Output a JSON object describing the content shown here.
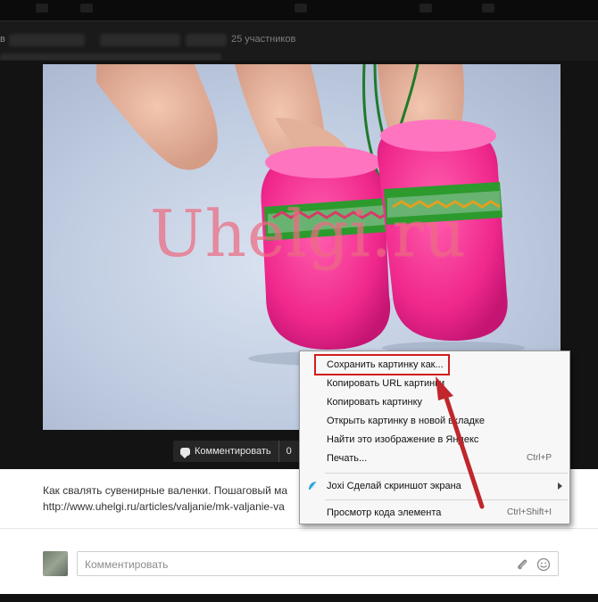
{
  "header": {
    "prefix": "в",
    "members": "25 участников"
  },
  "actions": {
    "comment_label": "Комментировать",
    "comment_count": "0"
  },
  "photo": {
    "watermark": "Uhelgi.ru"
  },
  "post": {
    "description_line1": "Как свалять сувенирные валенки. Пошаговый ма",
    "description_line2": "http://www.uhelgi.ru/articles/valjanie/mk-valjanie-va",
    "comment_placeholder": "Комментировать"
  },
  "context_menu": {
    "items": [
      {
        "label": "Сохранить картинку как..."
      },
      {
        "label": "Копировать URL картинки"
      },
      {
        "label": "Копировать картинку"
      },
      {
        "label": "Открыть картинку в новой вкладке"
      },
      {
        "label": "Найти это изображение в Яндекс"
      },
      {
        "label": "Печать...",
        "shortcut": "Ctrl+P"
      },
      {
        "label": "Joxi Сделай скриншот экрана"
      },
      {
        "label": "Просмотр кода элемента",
        "shortcut": "Ctrl+Shift+I"
      }
    ]
  },
  "colors": {
    "highlight": "#d21d1d",
    "arrow": "#c0262b",
    "slipper_pink": "#f0288c",
    "band_green": "#2d9a2d"
  },
  "icons": [
    "comment-bubble-icon",
    "paperclip-icon",
    "smile-icon",
    "joxi-icon",
    "submenu-arrow-icon"
  ]
}
